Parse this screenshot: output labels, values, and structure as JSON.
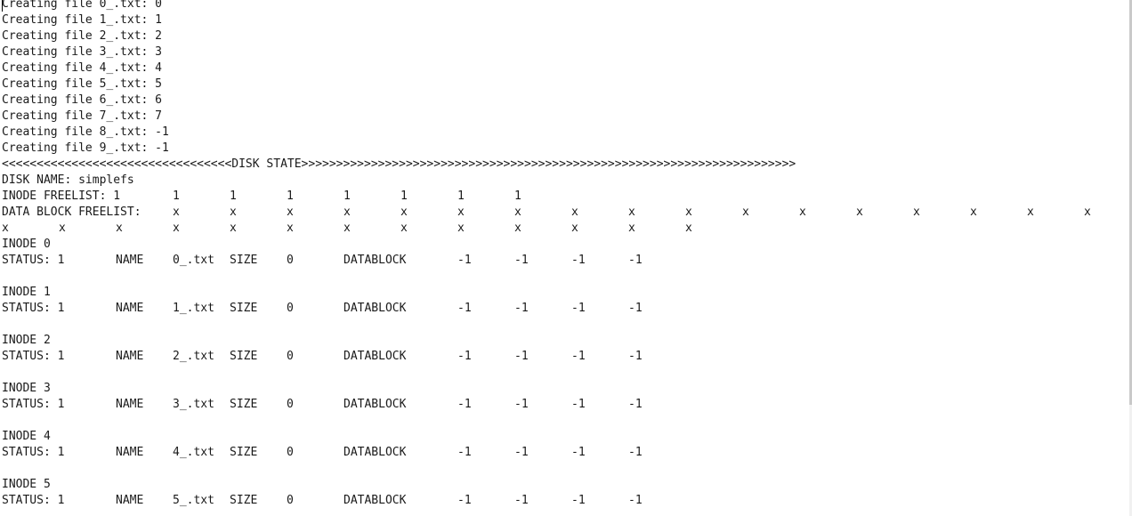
{
  "create_lines": [
    "Creating file 0_.txt: 0",
    "Creating file 1_.txt: 1",
    "Creating file 2_.txt: 2",
    "Creating file 3_.txt: 3",
    "Creating file 4_.txt: 4",
    "Creating file 5_.txt: 5",
    "Creating file 6_.txt: 6",
    "Creating file 7_.txt: 7",
    "Creating file 8_.txt: -1",
    "Creating file 9_.txt: -1"
  ],
  "disk_state_banner": "<<<<<<<<<<<<<<<<<<<<<<<<<<<<<<<<<DISK STATE>>>>>>>>>>>>>>>>>>>>>>>>>>>>>>>>>>>>>>>>>>>>>>>>>>>>>>>>>>>>>>>>>>>>>>>",
  "disk_name_line": "DISK NAME: simplefs",
  "inode_freelist": {
    "label": "INODE FREELIST: 1",
    "values": [
      "1",
      "1",
      "1",
      "1",
      "1",
      "1",
      "1"
    ]
  },
  "data_block_freelist": {
    "label": "DATA BLOCK FREELIST:",
    "row1": [
      "x",
      "x",
      "x",
      "x",
      "x",
      "x",
      "x",
      "x",
      "x",
      "x",
      "x",
      "x",
      "x",
      "x",
      "x",
      "x",
      "x"
    ],
    "row2": [
      "x",
      "x",
      "x",
      "x",
      "x",
      "x",
      "x",
      "x",
      "x",
      "x",
      "x",
      "x",
      "x"
    ]
  },
  "inodes": [
    {
      "header": "INODE 0",
      "status": "STATUS: 1",
      "name_label": "NAME",
      "name": "0_.txt",
      "size_label": "SIZE",
      "size": "0",
      "datablock_label": "DATABLOCK",
      "blocks": [
        "-1",
        "-1",
        "-1",
        "-1"
      ]
    },
    {
      "header": "INODE 1",
      "status": "STATUS: 1",
      "name_label": "NAME",
      "name": "1_.txt",
      "size_label": "SIZE",
      "size": "0",
      "datablock_label": "DATABLOCK",
      "blocks": [
        "-1",
        "-1",
        "-1",
        "-1"
      ]
    },
    {
      "header": "INODE 2",
      "status": "STATUS: 1",
      "name_label": "NAME",
      "name": "2_.txt",
      "size_label": "SIZE",
      "size": "0",
      "datablock_label": "DATABLOCK",
      "blocks": [
        "-1",
        "-1",
        "-1",
        "-1"
      ]
    },
    {
      "header": "INODE 3",
      "status": "STATUS: 1",
      "name_label": "NAME",
      "name": "3_.txt",
      "size_label": "SIZE",
      "size": "0",
      "datablock_label": "DATABLOCK",
      "blocks": [
        "-1",
        "-1",
        "-1",
        "-1"
      ]
    },
    {
      "header": "INODE 4",
      "status": "STATUS: 1",
      "name_label": "NAME",
      "name": "4_.txt",
      "size_label": "SIZE",
      "size": "0",
      "datablock_label": "DATABLOCK",
      "blocks": [
        "-1",
        "-1",
        "-1",
        "-1"
      ]
    },
    {
      "header": "INODE 5",
      "status": "STATUS: 1",
      "name_label": "NAME",
      "name": "5_.txt",
      "size_label": "SIZE",
      "size": "0",
      "datablock_label": "DATABLOCK",
      "blocks": [
        "-1",
        "-1",
        "-1",
        "-1"
      ]
    }
  ]
}
